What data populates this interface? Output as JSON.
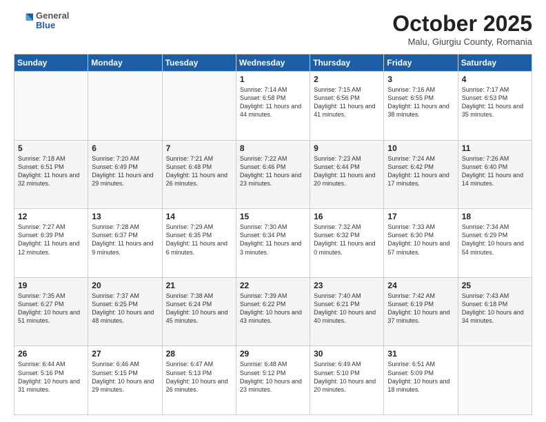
{
  "header": {
    "logo_general": "General",
    "logo_blue": "Blue",
    "title": "October 2025",
    "location": "Malu, Giurgiu County, Romania"
  },
  "days_of_week": [
    "Sunday",
    "Monday",
    "Tuesday",
    "Wednesday",
    "Thursday",
    "Friday",
    "Saturday"
  ],
  "weeks": [
    [
      {
        "day": "",
        "info": ""
      },
      {
        "day": "",
        "info": ""
      },
      {
        "day": "",
        "info": ""
      },
      {
        "day": "1",
        "info": "Sunrise: 7:14 AM\nSunset: 6:58 PM\nDaylight: 11 hours and 44 minutes."
      },
      {
        "day": "2",
        "info": "Sunrise: 7:15 AM\nSunset: 6:56 PM\nDaylight: 11 hours and 41 minutes."
      },
      {
        "day": "3",
        "info": "Sunrise: 7:16 AM\nSunset: 6:55 PM\nDaylight: 11 hours and 38 minutes."
      },
      {
        "day": "4",
        "info": "Sunrise: 7:17 AM\nSunset: 6:53 PM\nDaylight: 11 hours and 35 minutes."
      }
    ],
    [
      {
        "day": "5",
        "info": "Sunrise: 7:18 AM\nSunset: 6:51 PM\nDaylight: 11 hours and 32 minutes."
      },
      {
        "day": "6",
        "info": "Sunrise: 7:20 AM\nSunset: 6:49 PM\nDaylight: 11 hours and 29 minutes."
      },
      {
        "day": "7",
        "info": "Sunrise: 7:21 AM\nSunset: 6:48 PM\nDaylight: 11 hours and 26 minutes."
      },
      {
        "day": "8",
        "info": "Sunrise: 7:22 AM\nSunset: 6:46 PM\nDaylight: 11 hours and 23 minutes."
      },
      {
        "day": "9",
        "info": "Sunrise: 7:23 AM\nSunset: 6:44 PM\nDaylight: 11 hours and 20 minutes."
      },
      {
        "day": "10",
        "info": "Sunrise: 7:24 AM\nSunset: 6:42 PM\nDaylight: 11 hours and 17 minutes."
      },
      {
        "day": "11",
        "info": "Sunrise: 7:26 AM\nSunset: 6:40 PM\nDaylight: 11 hours and 14 minutes."
      }
    ],
    [
      {
        "day": "12",
        "info": "Sunrise: 7:27 AM\nSunset: 6:39 PM\nDaylight: 11 hours and 12 minutes."
      },
      {
        "day": "13",
        "info": "Sunrise: 7:28 AM\nSunset: 6:37 PM\nDaylight: 11 hours and 9 minutes."
      },
      {
        "day": "14",
        "info": "Sunrise: 7:29 AM\nSunset: 6:35 PM\nDaylight: 11 hours and 6 minutes."
      },
      {
        "day": "15",
        "info": "Sunrise: 7:30 AM\nSunset: 6:34 PM\nDaylight: 11 hours and 3 minutes."
      },
      {
        "day": "16",
        "info": "Sunrise: 7:32 AM\nSunset: 6:32 PM\nDaylight: 11 hours and 0 minutes."
      },
      {
        "day": "17",
        "info": "Sunrise: 7:33 AM\nSunset: 6:30 PM\nDaylight: 10 hours and 57 minutes."
      },
      {
        "day": "18",
        "info": "Sunrise: 7:34 AM\nSunset: 6:29 PM\nDaylight: 10 hours and 54 minutes."
      }
    ],
    [
      {
        "day": "19",
        "info": "Sunrise: 7:35 AM\nSunset: 6:27 PM\nDaylight: 10 hours and 51 minutes."
      },
      {
        "day": "20",
        "info": "Sunrise: 7:37 AM\nSunset: 6:25 PM\nDaylight: 10 hours and 48 minutes."
      },
      {
        "day": "21",
        "info": "Sunrise: 7:38 AM\nSunset: 6:24 PM\nDaylight: 10 hours and 45 minutes."
      },
      {
        "day": "22",
        "info": "Sunrise: 7:39 AM\nSunset: 6:22 PM\nDaylight: 10 hours and 43 minutes."
      },
      {
        "day": "23",
        "info": "Sunrise: 7:40 AM\nSunset: 6:21 PM\nDaylight: 10 hours and 40 minutes."
      },
      {
        "day": "24",
        "info": "Sunrise: 7:42 AM\nSunset: 6:19 PM\nDaylight: 10 hours and 37 minutes."
      },
      {
        "day": "25",
        "info": "Sunrise: 7:43 AM\nSunset: 6:18 PM\nDaylight: 10 hours and 34 minutes."
      }
    ],
    [
      {
        "day": "26",
        "info": "Sunrise: 6:44 AM\nSunset: 5:16 PM\nDaylight: 10 hours and 31 minutes."
      },
      {
        "day": "27",
        "info": "Sunrise: 6:46 AM\nSunset: 5:15 PM\nDaylight: 10 hours and 29 minutes."
      },
      {
        "day": "28",
        "info": "Sunrise: 6:47 AM\nSunset: 5:13 PM\nDaylight: 10 hours and 26 minutes."
      },
      {
        "day": "29",
        "info": "Sunrise: 6:48 AM\nSunset: 5:12 PM\nDaylight: 10 hours and 23 minutes."
      },
      {
        "day": "30",
        "info": "Sunrise: 6:49 AM\nSunset: 5:10 PM\nDaylight: 10 hours and 20 minutes."
      },
      {
        "day": "31",
        "info": "Sunrise: 6:51 AM\nSunset: 5:09 PM\nDaylight: 10 hours and 18 minutes."
      },
      {
        "day": "",
        "info": ""
      }
    ]
  ]
}
